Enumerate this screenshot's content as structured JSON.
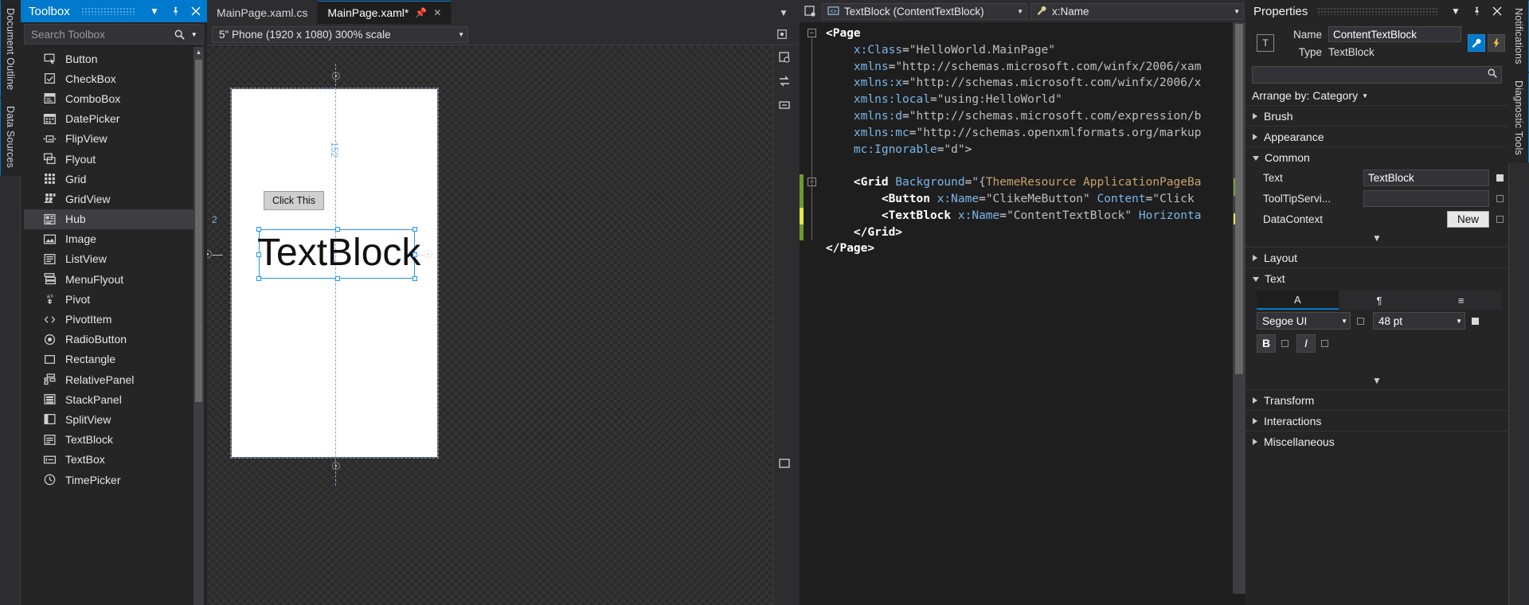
{
  "rails": {
    "left": [
      {
        "label": "Document Outline",
        "name": "document-outline-tab"
      },
      {
        "label": "Data Sources",
        "name": "data-sources-tab"
      }
    ],
    "right": [
      {
        "label": "Notifications",
        "name": "notifications-tab"
      },
      {
        "label": "Diagnostic Tools",
        "name": "diagnostic-tools-tab"
      }
    ]
  },
  "toolbox": {
    "title": "Toolbox",
    "dropdown_icon": "chevron-down-icon",
    "pin_icon": "pin-icon",
    "close_icon": "close-icon",
    "search_placeholder": "Search Toolbox",
    "search_icon": "search-icon",
    "search_dropdown_icon": "chevron-down-icon",
    "selected_item": "Hub",
    "items": [
      {
        "label": "Button",
        "icon": "button-icon"
      },
      {
        "label": "CheckBox",
        "icon": "checkbox-icon"
      },
      {
        "label": "ComboBox",
        "icon": "combobox-icon"
      },
      {
        "label": "DatePicker",
        "icon": "datepicker-icon"
      },
      {
        "label": "FlipView",
        "icon": "flipview-icon"
      },
      {
        "label": "Flyout",
        "icon": "flyout-icon"
      },
      {
        "label": "Grid",
        "icon": "grid-icon"
      },
      {
        "label": "GridView",
        "icon": "gridview-icon"
      },
      {
        "label": "Hub",
        "icon": "hub-icon"
      },
      {
        "label": "Image",
        "icon": "image-icon"
      },
      {
        "label": "ListView",
        "icon": "listview-icon"
      },
      {
        "label": "MenuFlyout",
        "icon": "menuflyout-icon"
      },
      {
        "label": "Pivot",
        "icon": "pivot-icon"
      },
      {
        "label": "PivotItem",
        "icon": "pivotitem-icon"
      },
      {
        "label": "RadioButton",
        "icon": "radiobutton-icon"
      },
      {
        "label": "Rectangle",
        "icon": "rectangle-icon"
      },
      {
        "label": "RelativePanel",
        "icon": "relativepanel-icon"
      },
      {
        "label": "StackPanel",
        "icon": "stackpanel-icon"
      },
      {
        "label": "SplitView",
        "icon": "splitview-icon"
      },
      {
        "label": "TextBlock",
        "icon": "textblock-icon"
      },
      {
        "label": "TextBox",
        "icon": "textbox-icon"
      },
      {
        "label": "TimePicker",
        "icon": "timepicker-icon"
      }
    ]
  },
  "tabs": [
    {
      "label": "MainPage.xaml.cs",
      "active": false,
      "close_icon": "close-icon"
    },
    {
      "label": "MainPage.xaml*",
      "active": true,
      "close_icon": "close-icon"
    }
  ],
  "designer": {
    "scale_label": "5\" Phone (1920 x 1080) 300% scale",
    "scale_dropdown_icon": "chevron-down-icon",
    "preview": {
      "button_label": "Click This",
      "textblock_label": "TextBlock",
      "measure_vertical": "152",
      "measure_horizontal": "2"
    }
  },
  "code": {
    "nav_left_label": "TextBlock (ContentTextBlock)",
    "nav_left_icon": "element-icon",
    "nav_right_label": "x:Name",
    "nav_right_icon": "wrench-icon",
    "nav_dropdown_icon": "chevron-down-icon",
    "lines": [
      {
        "indent": 0,
        "fold": "minus",
        "change": "none",
        "parts": [
          {
            "t": "<Page",
            "c": "k-tag"
          }
        ]
      },
      {
        "indent": 2,
        "fold": "",
        "change": "none",
        "parts": [
          {
            "t": "x:Class",
            "c": "k-attr"
          },
          {
            "t": "=",
            "c": "k-punct"
          },
          {
            "t": "\"HelloWorld.MainPage\"",
            "c": "k-val"
          }
        ]
      },
      {
        "indent": 2,
        "fold": "",
        "change": "none",
        "parts": [
          {
            "t": "xmlns",
            "c": "k-attr"
          },
          {
            "t": "=",
            "c": "k-punct"
          },
          {
            "t": "\"http://schemas.microsoft.com/winfx/2006/xam",
            "c": "k-val"
          }
        ]
      },
      {
        "indent": 2,
        "fold": "",
        "change": "none",
        "parts": [
          {
            "t": "xmlns:x",
            "c": "k-attr"
          },
          {
            "t": "=",
            "c": "k-punct"
          },
          {
            "t": "\"http://schemas.microsoft.com/winfx/2006/x",
            "c": "k-val"
          }
        ]
      },
      {
        "indent": 2,
        "fold": "",
        "change": "none",
        "parts": [
          {
            "t": "xmlns:local",
            "c": "k-attr"
          },
          {
            "t": "=",
            "c": "k-punct"
          },
          {
            "t": "\"using:HelloWorld\"",
            "c": "k-val"
          }
        ]
      },
      {
        "indent": 2,
        "fold": "",
        "change": "none",
        "parts": [
          {
            "t": "xmlns:d",
            "c": "k-attr"
          },
          {
            "t": "=",
            "c": "k-punct"
          },
          {
            "t": "\"http://schemas.microsoft.com/expression/b",
            "c": "k-val"
          }
        ]
      },
      {
        "indent": 2,
        "fold": "",
        "change": "none",
        "parts": [
          {
            "t": "xmlns:mc",
            "c": "k-attr"
          },
          {
            "t": "=",
            "c": "k-punct"
          },
          {
            "t": "\"http://schemas.openxmlformats.org/markup",
            "c": "k-val"
          }
        ]
      },
      {
        "indent": 2,
        "fold": "",
        "change": "none",
        "parts": [
          {
            "t": "mc:Ignorable",
            "c": "k-attr"
          },
          {
            "t": "=",
            "c": "k-punct"
          },
          {
            "t": "\"d\"",
            "c": "k-val"
          },
          {
            "t": ">",
            "c": "k-punct"
          }
        ]
      },
      {
        "indent": 0,
        "fold": "",
        "change": "none",
        "parts": []
      },
      {
        "indent": 2,
        "fold": "minus",
        "change": "saved",
        "parts": [
          {
            "t": "<Grid ",
            "c": "k-tag"
          },
          {
            "t": "Background",
            "c": "k-attr"
          },
          {
            "t": "=",
            "c": "k-punct"
          },
          {
            "t": "\"{",
            "c": "k-val"
          },
          {
            "t": "ThemeResource ApplicationPageBa",
            "c": "k-str"
          }
        ]
      },
      {
        "indent": 4,
        "fold": "",
        "change": "saved",
        "parts": [
          {
            "t": "<Button ",
            "c": "k-tag"
          },
          {
            "t": "x:Name",
            "c": "k-attr"
          },
          {
            "t": "=",
            "c": "k-punct"
          },
          {
            "t": "\"ClikeMeButton\" ",
            "c": "k-val"
          },
          {
            "t": "Content",
            "c": "k-attr"
          },
          {
            "t": "=",
            "c": "k-punct"
          },
          {
            "t": "\"Click",
            "c": "k-val"
          }
        ]
      },
      {
        "indent": 4,
        "fold": "",
        "change": "unsaved",
        "parts": [
          {
            "t": "<TextBlock ",
            "c": "k-tag"
          },
          {
            "t": "x:Name",
            "c": "k-attr"
          },
          {
            "t": "=",
            "c": "k-punct"
          },
          {
            "t": "\"ContentTextBlock\" ",
            "c": "k-val"
          },
          {
            "t": "Horizonta",
            "c": "k-attr"
          }
        ]
      },
      {
        "indent": 2,
        "fold": "",
        "change": "saved",
        "parts": [
          {
            "t": "</Grid>",
            "c": "k-tag"
          }
        ]
      },
      {
        "indent": 0,
        "fold": "",
        "change": "none",
        "parts": [
          {
            "t": "</Page>",
            "c": "k-tag"
          }
        ]
      }
    ]
  },
  "properties": {
    "title": "Properties",
    "dropdown_icon": "chevron-down-icon",
    "pin_icon": "pin-icon",
    "close_icon": "close-icon",
    "type_icon": "textblock-type-icon",
    "name_label": "Name",
    "name_value": "ContentTextBlock",
    "type_label": "Type",
    "type_value": "TextBlock",
    "tool_icons": [
      "wrench-icon",
      "lightning-icon"
    ],
    "search_placeholder": "",
    "search_icon": "search-icon",
    "arrange_label": "Arrange by: Category",
    "arrange_dropdown_icon": "chevron-down-icon",
    "categories": [
      {
        "label": "Brush",
        "state": "closed",
        "name": "category-brush"
      },
      {
        "label": "Appearance",
        "state": "closed",
        "name": "category-appearance"
      },
      {
        "label": "Common",
        "state": "open",
        "name": "category-common"
      }
    ],
    "common_rows": [
      {
        "label": "Text",
        "value": "TextBlock",
        "marker": "filled",
        "type": "input"
      },
      {
        "label": "ToolTipServi...",
        "value": "",
        "marker": "empty",
        "type": "input"
      },
      {
        "label": "DataContext",
        "value": "New",
        "marker": "empty",
        "type": "button"
      }
    ],
    "expand_chevron_icon": "chevron-down-icon",
    "more_categories": [
      {
        "label": "Layout",
        "state": "closed",
        "name": "category-layout"
      },
      {
        "label": "Text",
        "state": "open",
        "name": "category-text"
      }
    ],
    "text_section": {
      "tabs": [
        {
          "label": "A",
          "icon": "font-icon",
          "selected": true
        },
        {
          "label": "¶",
          "icon": "paragraph-icon",
          "selected": false
        },
        {
          "label": "≡",
          "icon": "text-options-icon",
          "selected": false
        }
      ],
      "font_family": "Segoe UI",
      "font_size": "48 pt",
      "font_family_dropdown_icon": "chevron-down-icon",
      "font_size_dropdown_icon": "chevron-down-icon",
      "bold_label": "B",
      "italic_label": "I"
    },
    "trailing_categories": [
      {
        "label": "Transform",
        "state": "closed",
        "name": "category-transform"
      },
      {
        "label": "Interactions",
        "state": "closed",
        "name": "category-interactions"
      },
      {
        "label": "Miscellaneous",
        "state": "closed",
        "name": "category-miscellaneous"
      }
    ]
  }
}
